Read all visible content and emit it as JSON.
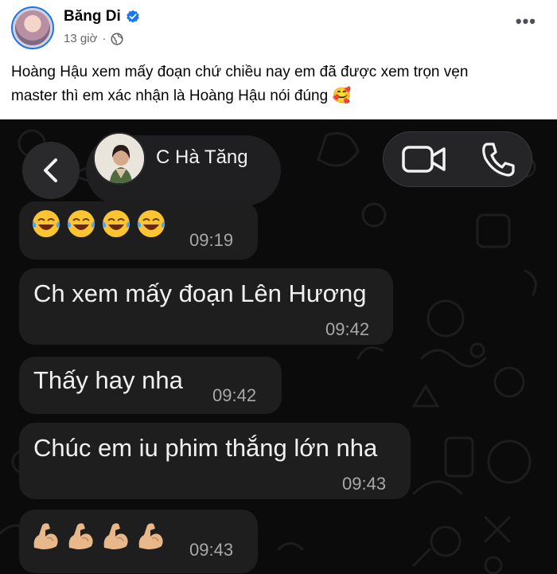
{
  "post": {
    "author_name": "Băng Di",
    "timestamp": "13 giờ",
    "separator": "·",
    "more_icon": "more-horizontal-icon",
    "caption_line1": "Hoàng Hậu xem mấy đoạn chứ chiều nay em đã được xem trọn vẹn",
    "caption_line2": "master thì em xác nhận là Hoàng Hậu nói đúng 🥰"
  },
  "chat": {
    "contact_name": "C Hà Tăng",
    "messages": [
      {
        "text": "😂😂😂😂",
        "time": "09:19"
      },
      {
        "text": "Ch xem mấy đoạn Lên Hương",
        "time": "09:42"
      },
      {
        "text": "Thấy hay nha",
        "time": "09:42"
      },
      {
        "text": "Chúc em iu phim thắng lớn nha",
        "time": "09:43"
      },
      {
        "text": "💪🏼💪🏼💪🏼💪🏼",
        "time": "09:43"
      }
    ]
  },
  "colors": {
    "brand_blue": "#1877f2",
    "chat_background": "#0b0b0b",
    "bubble": "#1e1e1e"
  }
}
